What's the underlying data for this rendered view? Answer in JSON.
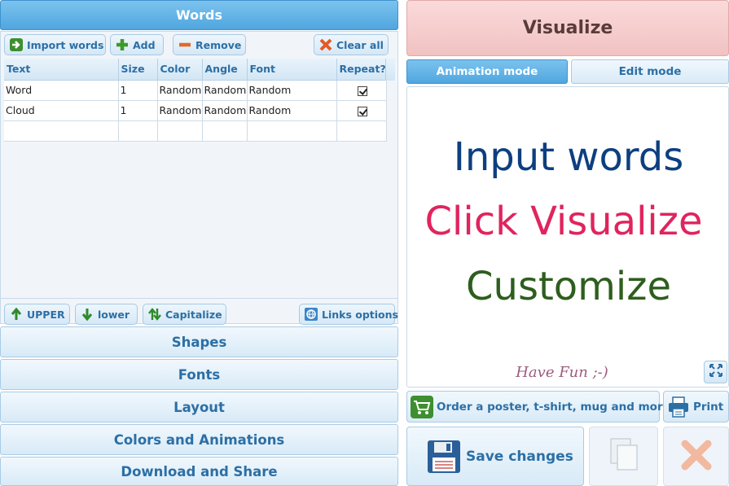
{
  "words_panel": {
    "title": "Words",
    "toolbar": {
      "import_label": "Import words",
      "add_label": "Add",
      "remove_label": "Remove",
      "clear_label": "Clear all"
    },
    "table": {
      "columns": [
        "Text",
        "Size",
        "Color",
        "Angle",
        "Font",
        "Repeat?"
      ],
      "rows": [
        {
          "text": "Word",
          "size": "1",
          "color": "Random",
          "angle": "Random",
          "font": "Random",
          "repeat": true
        },
        {
          "text": "Cloud",
          "size": "1",
          "color": "Random",
          "angle": "Random",
          "font": "Random",
          "repeat": true
        }
      ]
    },
    "case_toolbar": {
      "upper_label": "UPPER",
      "lower_label": "lower",
      "capitalize_label": "Capitalize",
      "links_label": "Links options"
    }
  },
  "accordion": {
    "shapes": "Shapes",
    "fonts": "Fonts",
    "layout": "Layout",
    "colors": "Colors and Animations",
    "download": "Download and Share"
  },
  "right_panel": {
    "visualize_label": "Visualize",
    "tabs": {
      "animation": "Animation mode",
      "edit": "Edit mode"
    },
    "preview": {
      "line1": "Input words",
      "line2": "Click Visualize",
      "line3": "Customize",
      "footer": "Have Fun ;-)"
    },
    "order_label": "Order a poster, t-shirt, mug and more!",
    "print_label": "Print",
    "save_label": "Save changes"
  },
  "colors": {
    "accent_blue": "#2c6fa5",
    "header_blue": "#4fa6df",
    "line1": "#0d3f80",
    "line2": "#e0245e",
    "line3": "#2e5e1e",
    "footer": "#9c5b7d"
  }
}
